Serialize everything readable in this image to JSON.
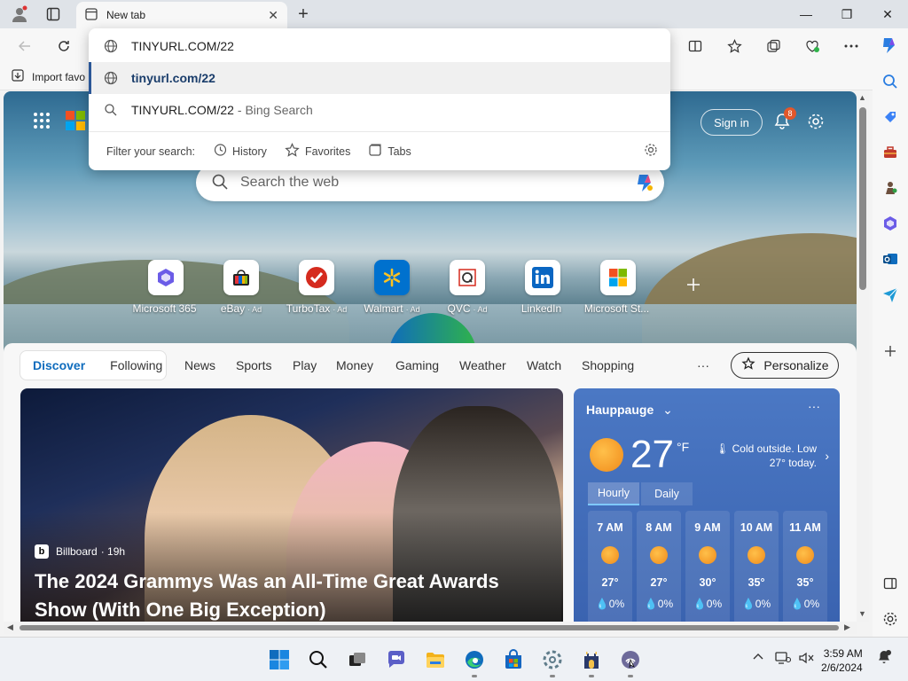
{
  "window": {
    "tab_title": "New tab",
    "new_tab_symbol": "+",
    "minimize_symbol": "—",
    "restore_symbol": "❐",
    "close_symbol": "✕"
  },
  "favorites_bar": {
    "import_label": "Import favo"
  },
  "address_dropdown": {
    "typed_text": "TINYURL.COM/22",
    "url_suggestion": "tinyurl.com/22",
    "search_query": "TINYURL.COM/22",
    "search_suffix": "- Bing Search",
    "filter_label": "Filter your search:",
    "filters": [
      {
        "label": "History"
      },
      {
        "label": "Favorites"
      },
      {
        "label": "Tabs"
      }
    ]
  },
  "hero": {
    "sign_in_label": "Sign in",
    "notification_count": "8",
    "search_placeholder": "Search the web",
    "quick_links": [
      {
        "label": "Microsoft 365",
        "ad": ""
      },
      {
        "label": "eBay",
        "ad": "· Ad"
      },
      {
        "label": "TurboTax",
        "ad": "· Ad"
      },
      {
        "label": "Walmart",
        "ad": "· Ad"
      },
      {
        "label": "QVC",
        "ad": "· Ad"
      },
      {
        "label": "LinkedIn",
        "ad": ""
      },
      {
        "label": "Microsoft St...",
        "ad": ""
      }
    ]
  },
  "feed_nav": {
    "segments": [
      {
        "label": "Discover",
        "active": true
      },
      {
        "label": "Following",
        "active": false
      }
    ],
    "links": [
      "News",
      "Sports",
      "Play",
      "Money",
      "Gaming",
      "Weather",
      "Watch",
      "Shopping"
    ],
    "more_label": "···",
    "personalize_label": "Personalize"
  },
  "news_card": {
    "source": "Billboard",
    "age": "· 19h",
    "headline": "The 2024 Grammys Was an All-Time Great Awards Show (With One Big Exception)"
  },
  "weather": {
    "location": "Hauppauge",
    "more_label": "···",
    "temperature": "27",
    "unit": "°F",
    "note": "Cold outside. Low 27° today.",
    "tabs": [
      "Hourly",
      "Daily"
    ],
    "hourly": [
      {
        "time": "7 AM",
        "temp": "27°",
        "precip": "0%"
      },
      {
        "time": "8 AM",
        "temp": "27°",
        "precip": "0%"
      },
      {
        "time": "9 AM",
        "temp": "30°",
        "precip": "0%"
      },
      {
        "time": "10 AM",
        "temp": "35°",
        "precip": "0%"
      },
      {
        "time": "11 AM",
        "temp": "35°",
        "precip": "0%"
      }
    ]
  },
  "taskbar": {
    "time": "3:59 AM",
    "date": "2/6/2024"
  },
  "colors": {
    "accent": "#0f6cbd",
    "weather_bg": "#4b78c4",
    "badge": "#e2572b"
  }
}
